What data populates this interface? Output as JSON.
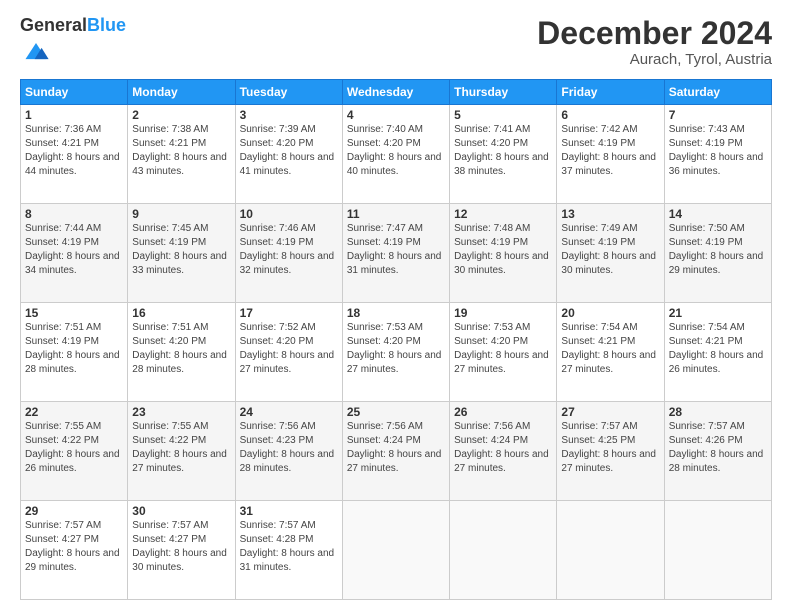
{
  "header": {
    "logo_general": "General",
    "logo_blue": "Blue",
    "month_year": "December 2024",
    "location": "Aurach, Tyrol, Austria"
  },
  "days_of_week": [
    "Sunday",
    "Monday",
    "Tuesday",
    "Wednesday",
    "Thursday",
    "Friday",
    "Saturday"
  ],
  "weeks": [
    [
      {
        "day": "1",
        "sunrise": "Sunrise: 7:36 AM",
        "sunset": "Sunset: 4:21 PM",
        "daylight": "Daylight: 8 hours and 44 minutes."
      },
      {
        "day": "2",
        "sunrise": "Sunrise: 7:38 AM",
        "sunset": "Sunset: 4:21 PM",
        "daylight": "Daylight: 8 hours and 43 minutes."
      },
      {
        "day": "3",
        "sunrise": "Sunrise: 7:39 AM",
        "sunset": "Sunset: 4:20 PM",
        "daylight": "Daylight: 8 hours and 41 minutes."
      },
      {
        "day": "4",
        "sunrise": "Sunrise: 7:40 AM",
        "sunset": "Sunset: 4:20 PM",
        "daylight": "Daylight: 8 hours and 40 minutes."
      },
      {
        "day": "5",
        "sunrise": "Sunrise: 7:41 AM",
        "sunset": "Sunset: 4:20 PM",
        "daylight": "Daylight: 8 hours and 38 minutes."
      },
      {
        "day": "6",
        "sunrise": "Sunrise: 7:42 AM",
        "sunset": "Sunset: 4:19 PM",
        "daylight": "Daylight: 8 hours and 37 minutes."
      },
      {
        "day": "7",
        "sunrise": "Sunrise: 7:43 AM",
        "sunset": "Sunset: 4:19 PM",
        "daylight": "Daylight: 8 hours and 36 minutes."
      }
    ],
    [
      {
        "day": "8",
        "sunrise": "Sunrise: 7:44 AM",
        "sunset": "Sunset: 4:19 PM",
        "daylight": "Daylight: 8 hours and 34 minutes."
      },
      {
        "day": "9",
        "sunrise": "Sunrise: 7:45 AM",
        "sunset": "Sunset: 4:19 PM",
        "daylight": "Daylight: 8 hours and 33 minutes."
      },
      {
        "day": "10",
        "sunrise": "Sunrise: 7:46 AM",
        "sunset": "Sunset: 4:19 PM",
        "daylight": "Daylight: 8 hours and 32 minutes."
      },
      {
        "day": "11",
        "sunrise": "Sunrise: 7:47 AM",
        "sunset": "Sunset: 4:19 PM",
        "daylight": "Daylight: 8 hours and 31 minutes."
      },
      {
        "day": "12",
        "sunrise": "Sunrise: 7:48 AM",
        "sunset": "Sunset: 4:19 PM",
        "daylight": "Daylight: 8 hours and 30 minutes."
      },
      {
        "day": "13",
        "sunrise": "Sunrise: 7:49 AM",
        "sunset": "Sunset: 4:19 PM",
        "daylight": "Daylight: 8 hours and 30 minutes."
      },
      {
        "day": "14",
        "sunrise": "Sunrise: 7:50 AM",
        "sunset": "Sunset: 4:19 PM",
        "daylight": "Daylight: 8 hours and 29 minutes."
      }
    ],
    [
      {
        "day": "15",
        "sunrise": "Sunrise: 7:51 AM",
        "sunset": "Sunset: 4:19 PM",
        "daylight": "Daylight: 8 hours and 28 minutes."
      },
      {
        "day": "16",
        "sunrise": "Sunrise: 7:51 AM",
        "sunset": "Sunset: 4:20 PM",
        "daylight": "Daylight: 8 hours and 28 minutes."
      },
      {
        "day": "17",
        "sunrise": "Sunrise: 7:52 AM",
        "sunset": "Sunset: 4:20 PM",
        "daylight": "Daylight: 8 hours and 27 minutes."
      },
      {
        "day": "18",
        "sunrise": "Sunrise: 7:53 AM",
        "sunset": "Sunset: 4:20 PM",
        "daylight": "Daylight: 8 hours and 27 minutes."
      },
      {
        "day": "19",
        "sunrise": "Sunrise: 7:53 AM",
        "sunset": "Sunset: 4:20 PM",
        "daylight": "Daylight: 8 hours and 27 minutes."
      },
      {
        "day": "20",
        "sunrise": "Sunrise: 7:54 AM",
        "sunset": "Sunset: 4:21 PM",
        "daylight": "Daylight: 8 hours and 27 minutes."
      },
      {
        "day": "21",
        "sunrise": "Sunrise: 7:54 AM",
        "sunset": "Sunset: 4:21 PM",
        "daylight": "Daylight: 8 hours and 26 minutes."
      }
    ],
    [
      {
        "day": "22",
        "sunrise": "Sunrise: 7:55 AM",
        "sunset": "Sunset: 4:22 PM",
        "daylight": "Daylight: 8 hours and 26 minutes."
      },
      {
        "day": "23",
        "sunrise": "Sunrise: 7:55 AM",
        "sunset": "Sunset: 4:22 PM",
        "daylight": "Daylight: 8 hours and 27 minutes."
      },
      {
        "day": "24",
        "sunrise": "Sunrise: 7:56 AM",
        "sunset": "Sunset: 4:23 PM",
        "daylight": "Daylight: 8 hours and 28 minutes."
      },
      {
        "day": "25",
        "sunrise": "Sunrise: 7:56 AM",
        "sunset": "Sunset: 4:24 PM",
        "daylight": "Daylight: 8 hours and 27 minutes."
      },
      {
        "day": "26",
        "sunrise": "Sunrise: 7:56 AM",
        "sunset": "Sunset: 4:24 PM",
        "daylight": "Daylight: 8 hours and 27 minutes."
      },
      {
        "day": "27",
        "sunrise": "Sunrise: 7:57 AM",
        "sunset": "Sunset: 4:25 PM",
        "daylight": "Daylight: 8 hours and 27 minutes."
      },
      {
        "day": "28",
        "sunrise": "Sunrise: 7:57 AM",
        "sunset": "Sunset: 4:26 PM",
        "daylight": "Daylight: 8 hours and 28 minutes."
      }
    ],
    [
      {
        "day": "29",
        "sunrise": "Sunrise: 7:57 AM",
        "sunset": "Sunset: 4:27 PM",
        "daylight": "Daylight: 8 hours and 29 minutes."
      },
      {
        "day": "30",
        "sunrise": "Sunrise: 7:57 AM",
        "sunset": "Sunset: 4:27 PM",
        "daylight": "Daylight: 8 hours and 30 minutes."
      },
      {
        "day": "31",
        "sunrise": "Sunrise: 7:57 AM",
        "sunset": "Sunset: 4:28 PM",
        "daylight": "Daylight: 8 hours and 31 minutes."
      },
      null,
      null,
      null,
      null
    ]
  ]
}
